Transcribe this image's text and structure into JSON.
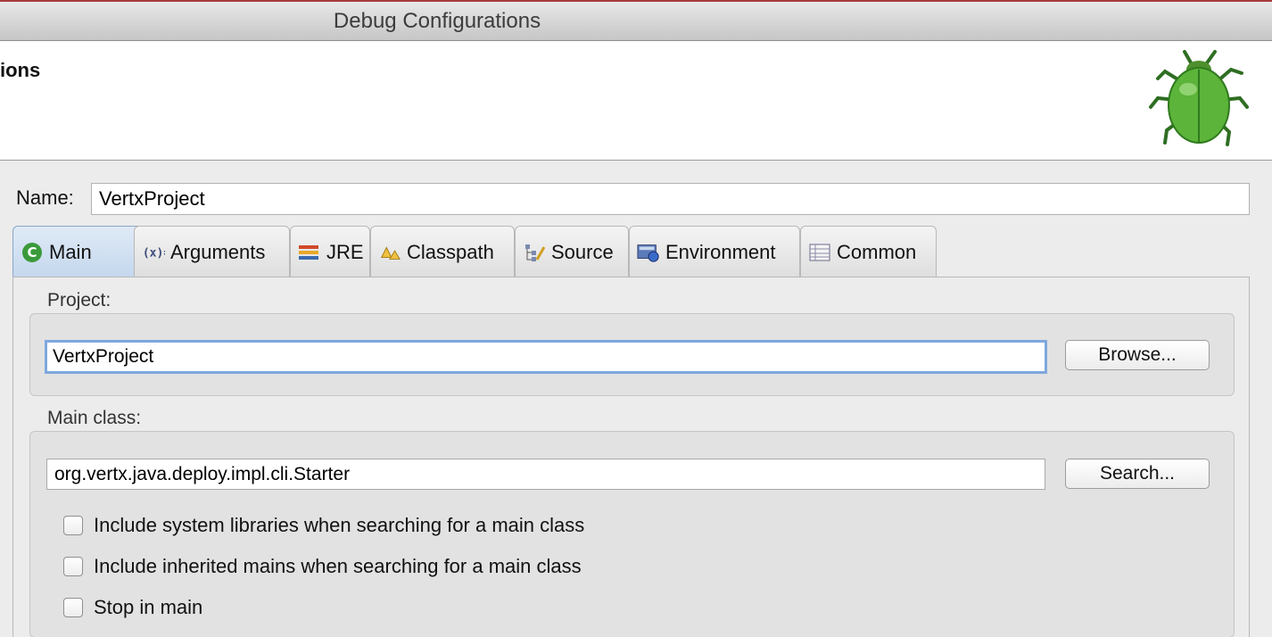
{
  "window": {
    "title": "Debug Configurations"
  },
  "header": {
    "title_fragment": "ions"
  },
  "name_field": {
    "label": "Name:",
    "value": "VertxProject"
  },
  "tabs": [
    {
      "label": "Main",
      "icon": "main-run-icon",
      "active": true
    },
    {
      "label": "Arguments",
      "icon": "arguments-icon",
      "active": false
    },
    {
      "label": "JRE",
      "icon": "jre-icon",
      "active": false
    },
    {
      "label": "Classpath",
      "icon": "classpath-icon",
      "active": false
    },
    {
      "label": "Source",
      "icon": "source-icon",
      "active": false
    },
    {
      "label": "Environment",
      "icon": "environment-icon",
      "active": false
    },
    {
      "label": "Common",
      "icon": "common-icon",
      "active": false
    }
  ],
  "project": {
    "label": "Project:",
    "value": "VertxProject",
    "browse_label": "Browse..."
  },
  "main_class": {
    "label": "Main class:",
    "value": "org.vertx.java.deploy.impl.cli.Starter",
    "search_label": "Search..."
  },
  "options": [
    {
      "label": "Include system libraries when searching for a main class",
      "checked": false
    },
    {
      "label": "Include inherited mains when searching for a main class",
      "checked": false
    },
    {
      "label": "Stop in main",
      "checked": false
    }
  ],
  "colors": {
    "accent": "#7fa8dd",
    "bug_green": "#3f9a2c"
  }
}
